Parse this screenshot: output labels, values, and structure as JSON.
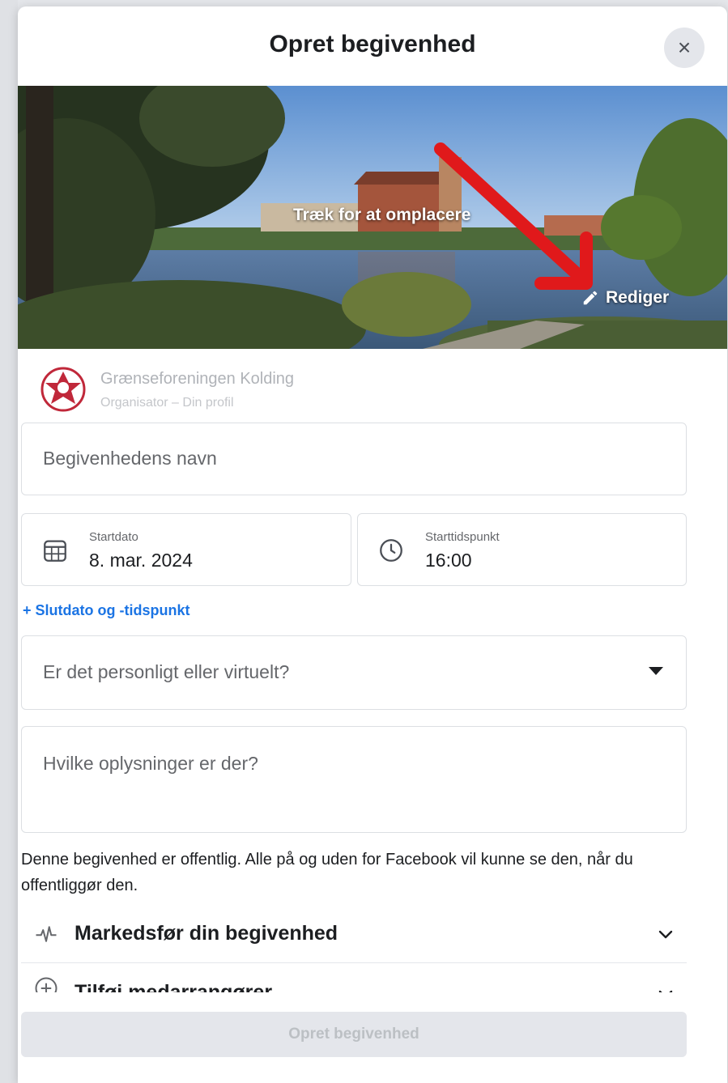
{
  "dialog": {
    "title": "Opret begivenhed",
    "close_symbol": "×"
  },
  "cover": {
    "drag_hint": "Træk for at omplacere",
    "edit_label": "Rediger"
  },
  "organizer": {
    "name": "Grænseforeningen Kolding",
    "role": "Organisator – Din profil"
  },
  "form": {
    "name_placeholder": "Begivenhedens navn",
    "start_date_label": "Startdato",
    "start_date_value": "8. mar. 2024",
    "start_time_label": "Starttidspunkt",
    "start_time_value": "16:00",
    "end_link": "+ Slutdato og -tidspunkt",
    "location_placeholder": "Er det personligt eller virtuelt?",
    "description_placeholder": "Hvilke oplysninger er der?"
  },
  "notice": "Denne begivenhed er offentlig. Alle på og uden for Facebook vil kunne se den, når du offentliggør den.",
  "sections": {
    "market": "Markedsfør din begivenhed",
    "cohost": "Tilføj medarrangører"
  },
  "submit_label": "Opret begivenhed",
  "icons": {
    "close": "close-icon",
    "edit": "pencil-icon",
    "calendar": "calendar-icon",
    "clock": "clock-icon",
    "dropdown": "caret-down-icon",
    "market": "pulse-icon",
    "cohost": "add-circle-icon",
    "chevron": "chevron-down-icon"
  },
  "colors": {
    "link": "#1b74e4",
    "annotation_arrow": "#e0191b"
  }
}
